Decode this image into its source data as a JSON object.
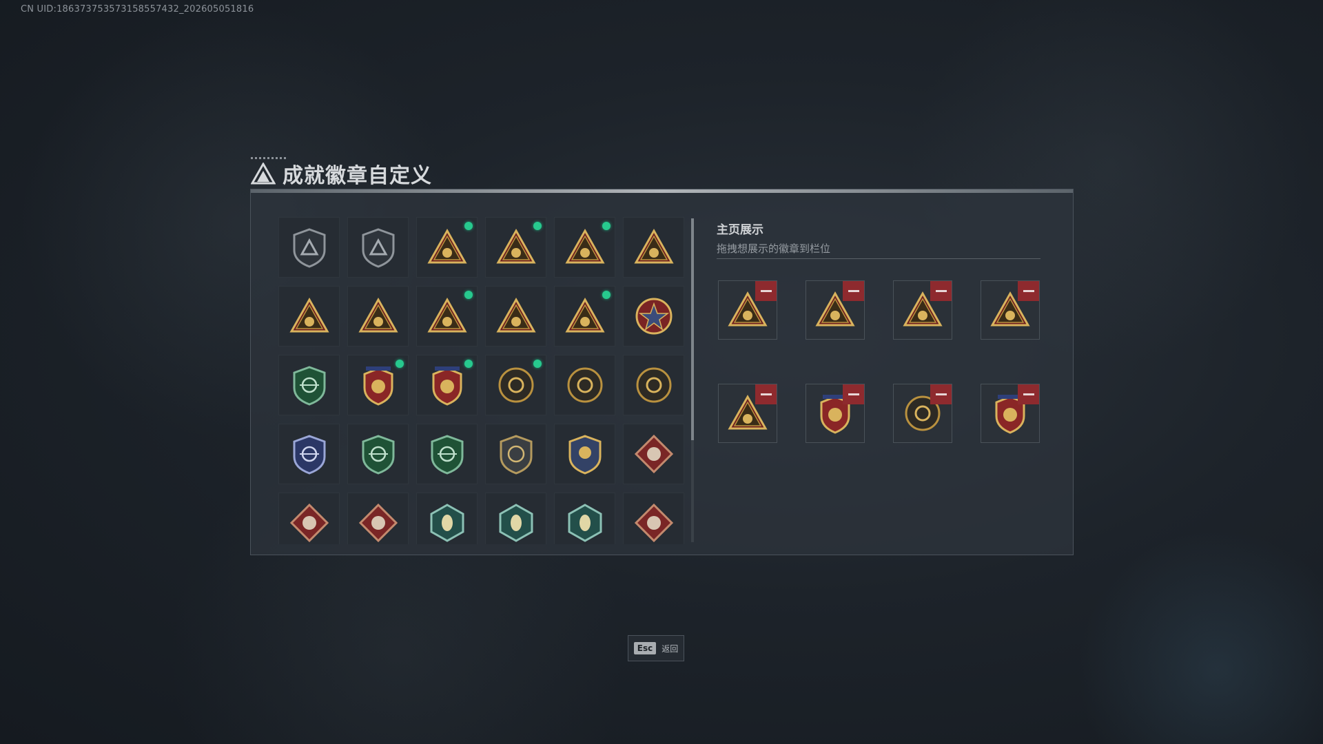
{
  "uid_text": "CN UID:186373753573158557432_202605051816",
  "title": "成就徽章自定义",
  "showcase": {
    "title": "主页展示",
    "subtitle": "拖拽想展示的徽章到栏位"
  },
  "esc": {
    "key": "Esc",
    "label": "返回"
  },
  "colors": {
    "accent_green": "#27c98e",
    "remove_red": "#8e2a2e",
    "gold": "#c9a24a"
  },
  "badge_grid": [
    {
      "icon": "shield-delta-icon",
      "new": false
    },
    {
      "icon": "shield-helicopter-icon",
      "new": false
    },
    {
      "icon": "tri-tank-icon",
      "new": true
    },
    {
      "icon": "tri-soldier-icon",
      "new": true
    },
    {
      "icon": "tri-globe-eri-icon",
      "new": true
    },
    {
      "icon": "tri-wing-icon",
      "new": false
    },
    {
      "icon": "tri-gun-icon",
      "new": false
    },
    {
      "icon": "tri-number-one-icon",
      "new": false
    },
    {
      "icon": "tri-crate-icon",
      "new": true
    },
    {
      "icon": "tri-squad-icon",
      "new": false
    },
    {
      "icon": "tri-rocket-icon",
      "new": true
    },
    {
      "icon": "star-medallion-icon",
      "new": false
    },
    {
      "icon": "green-shield-icon",
      "new": false
    },
    {
      "icon": "red-shield-stars-icon",
      "new": true
    },
    {
      "icon": "red-shield-stars-2-icon",
      "new": true
    },
    {
      "icon": "round-swirl-icon",
      "new": true
    },
    {
      "icon": "round-skull-icon",
      "new": false
    },
    {
      "icon": "round-eye-icon",
      "new": false
    },
    {
      "icon": "blue-rifle-shield-icon",
      "new": false
    },
    {
      "icon": "green-rifle-shield-icon",
      "new": false
    },
    {
      "icon": "green-rifle-shield-2-icon",
      "new": false
    },
    {
      "icon": "gray-sniper-shield-icon",
      "new": false
    },
    {
      "icon": "gold-anchor-shield-icon",
      "new": false
    },
    {
      "icon": "red-wolf-diamond-icon",
      "new": false
    },
    {
      "icon": "red-wolf-diamond-2-icon",
      "new": false
    },
    {
      "icon": "red-wing-diamond-icon",
      "new": false
    },
    {
      "icon": "green-wasp-hex-icon",
      "new": false
    },
    {
      "icon": "green-wasp-hex-2-icon",
      "new": false
    },
    {
      "icon": "green-drill-hex-icon",
      "new": false
    },
    {
      "icon": "red-dragon-diamond-icon",
      "new": false
    }
  ],
  "showcase_slots": [
    {
      "icon": "tri-tank-icon"
    },
    {
      "icon": "tri-soldier-icon"
    },
    {
      "icon": "tri-globe-eri-icon"
    },
    {
      "icon": "tri-crate-icon"
    },
    {
      "icon": "tri-rocket-icon"
    },
    {
      "icon": "red-shield-stars-2-icon"
    },
    {
      "icon": "round-swirl-icon"
    },
    {
      "icon": "red-shield-stars-icon"
    }
  ]
}
